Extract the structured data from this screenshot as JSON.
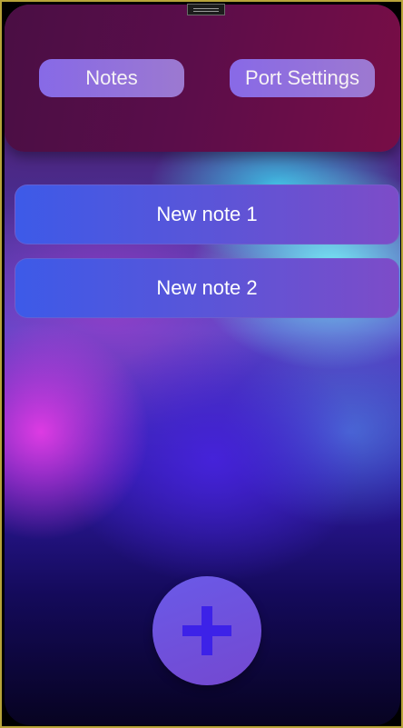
{
  "header": {
    "buttons": [
      {
        "label": "Notes"
      },
      {
        "label": "Port Settings"
      }
    ]
  },
  "notes": [
    {
      "title": "New note 1"
    },
    {
      "title": "New note 2"
    }
  ],
  "fab": {
    "icon": "plus-icon"
  },
  "colors": {
    "header_bg": "#5a0d4a",
    "button_bg": "#8b6ff0",
    "note_bg": "#4d58e0",
    "fab_bg": "#6a5ae8",
    "fab_icon": "#3d22e8",
    "frame_border": "#b8a43a"
  }
}
